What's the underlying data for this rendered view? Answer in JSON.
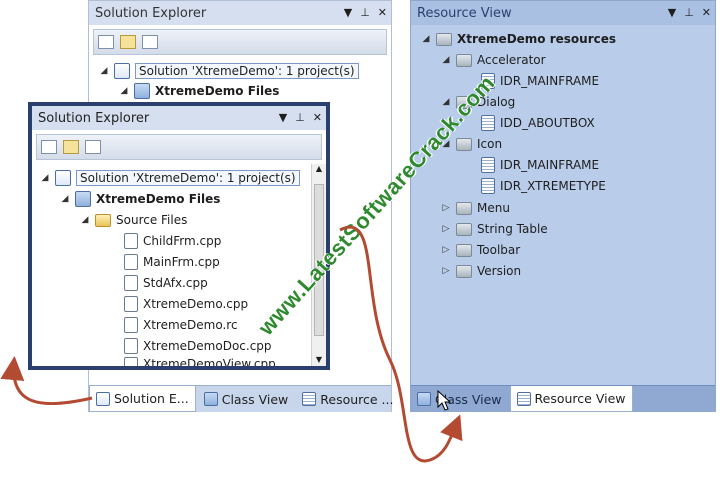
{
  "back_panel": {
    "title": "Solution Explorer",
    "rows": [
      {
        "label": "Solution 'XtremeDemo': 1 project(s)"
      },
      {
        "label": "XtremeDemo Files"
      }
    ],
    "tabs": [
      {
        "label": "Solution E..."
      },
      {
        "label": "Class View"
      },
      {
        "label": "Resource ..."
      }
    ]
  },
  "front_panel": {
    "title": "Solution Explorer",
    "rows": [
      {
        "label": "Solution 'XtremeDemo': 1 project(s)"
      },
      {
        "label": "XtremeDemo Files"
      },
      {
        "label": "Source Files"
      },
      {
        "label": "ChildFrm.cpp"
      },
      {
        "label": "MainFrm.cpp"
      },
      {
        "label": "StdAfx.cpp"
      },
      {
        "label": "XtremeDemo.cpp"
      },
      {
        "label": "XtremeDemo.rc"
      },
      {
        "label": "XtremeDemoDoc.cpp"
      },
      {
        "label": "XtremeDemoView.cpp"
      }
    ]
  },
  "resource_panel": {
    "title": "Resource View",
    "rows": [
      {
        "label": "XtremeDemo resources"
      },
      {
        "label": "Accelerator"
      },
      {
        "label": "IDR_MAINFRAME"
      },
      {
        "label": "Dialog"
      },
      {
        "label": "IDD_ABOUTBOX"
      },
      {
        "label": "Icon"
      },
      {
        "label": "IDR_MAINFRAME"
      },
      {
        "label": "IDR_XTREMETYPE"
      },
      {
        "label": "Menu"
      },
      {
        "label": "String Table"
      },
      {
        "label": "Toolbar"
      },
      {
        "label": "Version"
      }
    ],
    "tabs": [
      {
        "label": "Class View"
      },
      {
        "label": "Resource View"
      }
    ]
  },
  "watermark": "www.LatestSoftwareCrack.com",
  "colors": {
    "header_bg": "#d6dff0",
    "resource_bg": "#b9cdea",
    "frame_dark": "#2b3f6e",
    "arrow": "#b34a32",
    "watermark": "#2f8a2f"
  },
  "icons": [
    "pin-icon",
    "close-icon",
    "dropdown-icon",
    "solution-icon",
    "project-icon",
    "folder-icon",
    "cpp-file-icon",
    "resource-icon"
  ]
}
